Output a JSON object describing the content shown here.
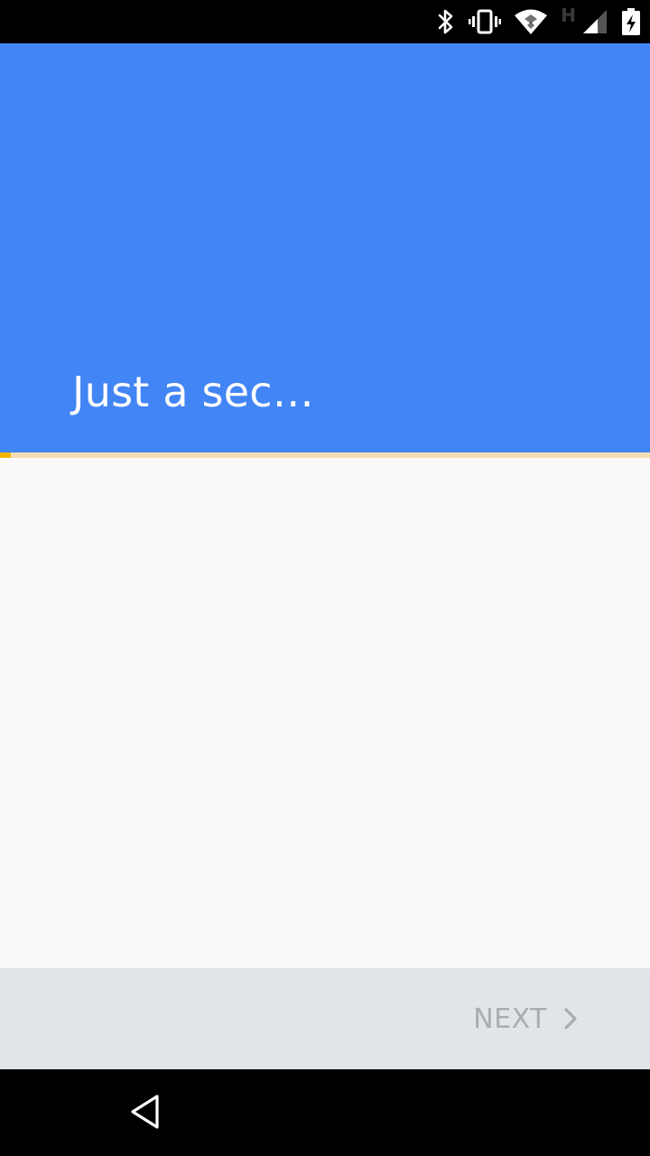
{
  "status_bar": {
    "icons": [
      "bluetooth-icon",
      "vibrate-icon",
      "wifi-icon",
      "cell-signal-icon",
      "battery-charging-icon"
    ],
    "network_type": "H"
  },
  "header": {
    "title": "Just a sec…",
    "background_color": "#4285f4"
  },
  "progress": {
    "fraction": 0.017,
    "track_color": "#f4ddb1",
    "fill_color": "#f4b400"
  },
  "footer": {
    "next_label": "NEXT",
    "next_enabled": false,
    "next_icon": "chevron-right-icon"
  },
  "nav_bar": {
    "back_icon": "back-triangle-icon"
  }
}
